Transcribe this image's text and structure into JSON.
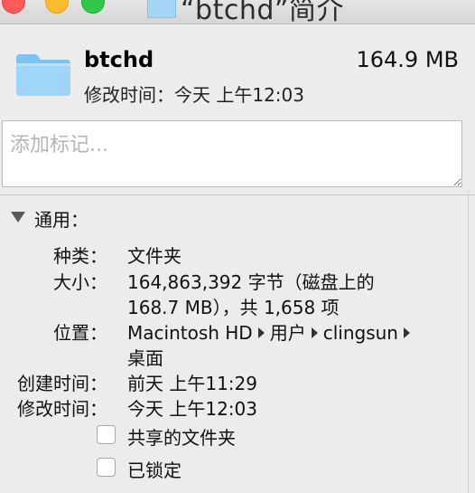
{
  "window": {
    "title": "“btchd”简介",
    "controls": [
      "close",
      "minimize",
      "zoom"
    ]
  },
  "header": {
    "icon": "folder-icon",
    "name": "btchd",
    "size": "164.9 MB",
    "modified": "修改时间：今天 上午12:03"
  },
  "tags": {
    "placeholder": "添加标记..."
  },
  "general": {
    "title": "通用：",
    "kind_label": "种类：",
    "kind_value": "文件夹",
    "size_label": "大小：",
    "size_value_line1": "164,863,392 字节（磁盘上的",
    "size_value_line2": "168.7 MB），共 1,658 项",
    "where_label": "位置：",
    "where_path": [
      "Macintosh HD",
      "用户",
      "clingsun",
      "桌面"
    ],
    "created_label": "创建时间：",
    "created_value": "前天 上午11:29",
    "modified_label": "修改时间：",
    "modified_value": "今天 上午12:03",
    "shared_label": "共享的文件夹",
    "shared_checked": false,
    "locked_label": "已锁定",
    "locked_checked": false
  },
  "colors": {
    "folder": "#8ccbf4",
    "window_bg": "#ececec",
    "close": "#fc5b57",
    "minimize": "#fdbc2e",
    "zoom": "#33c748"
  }
}
